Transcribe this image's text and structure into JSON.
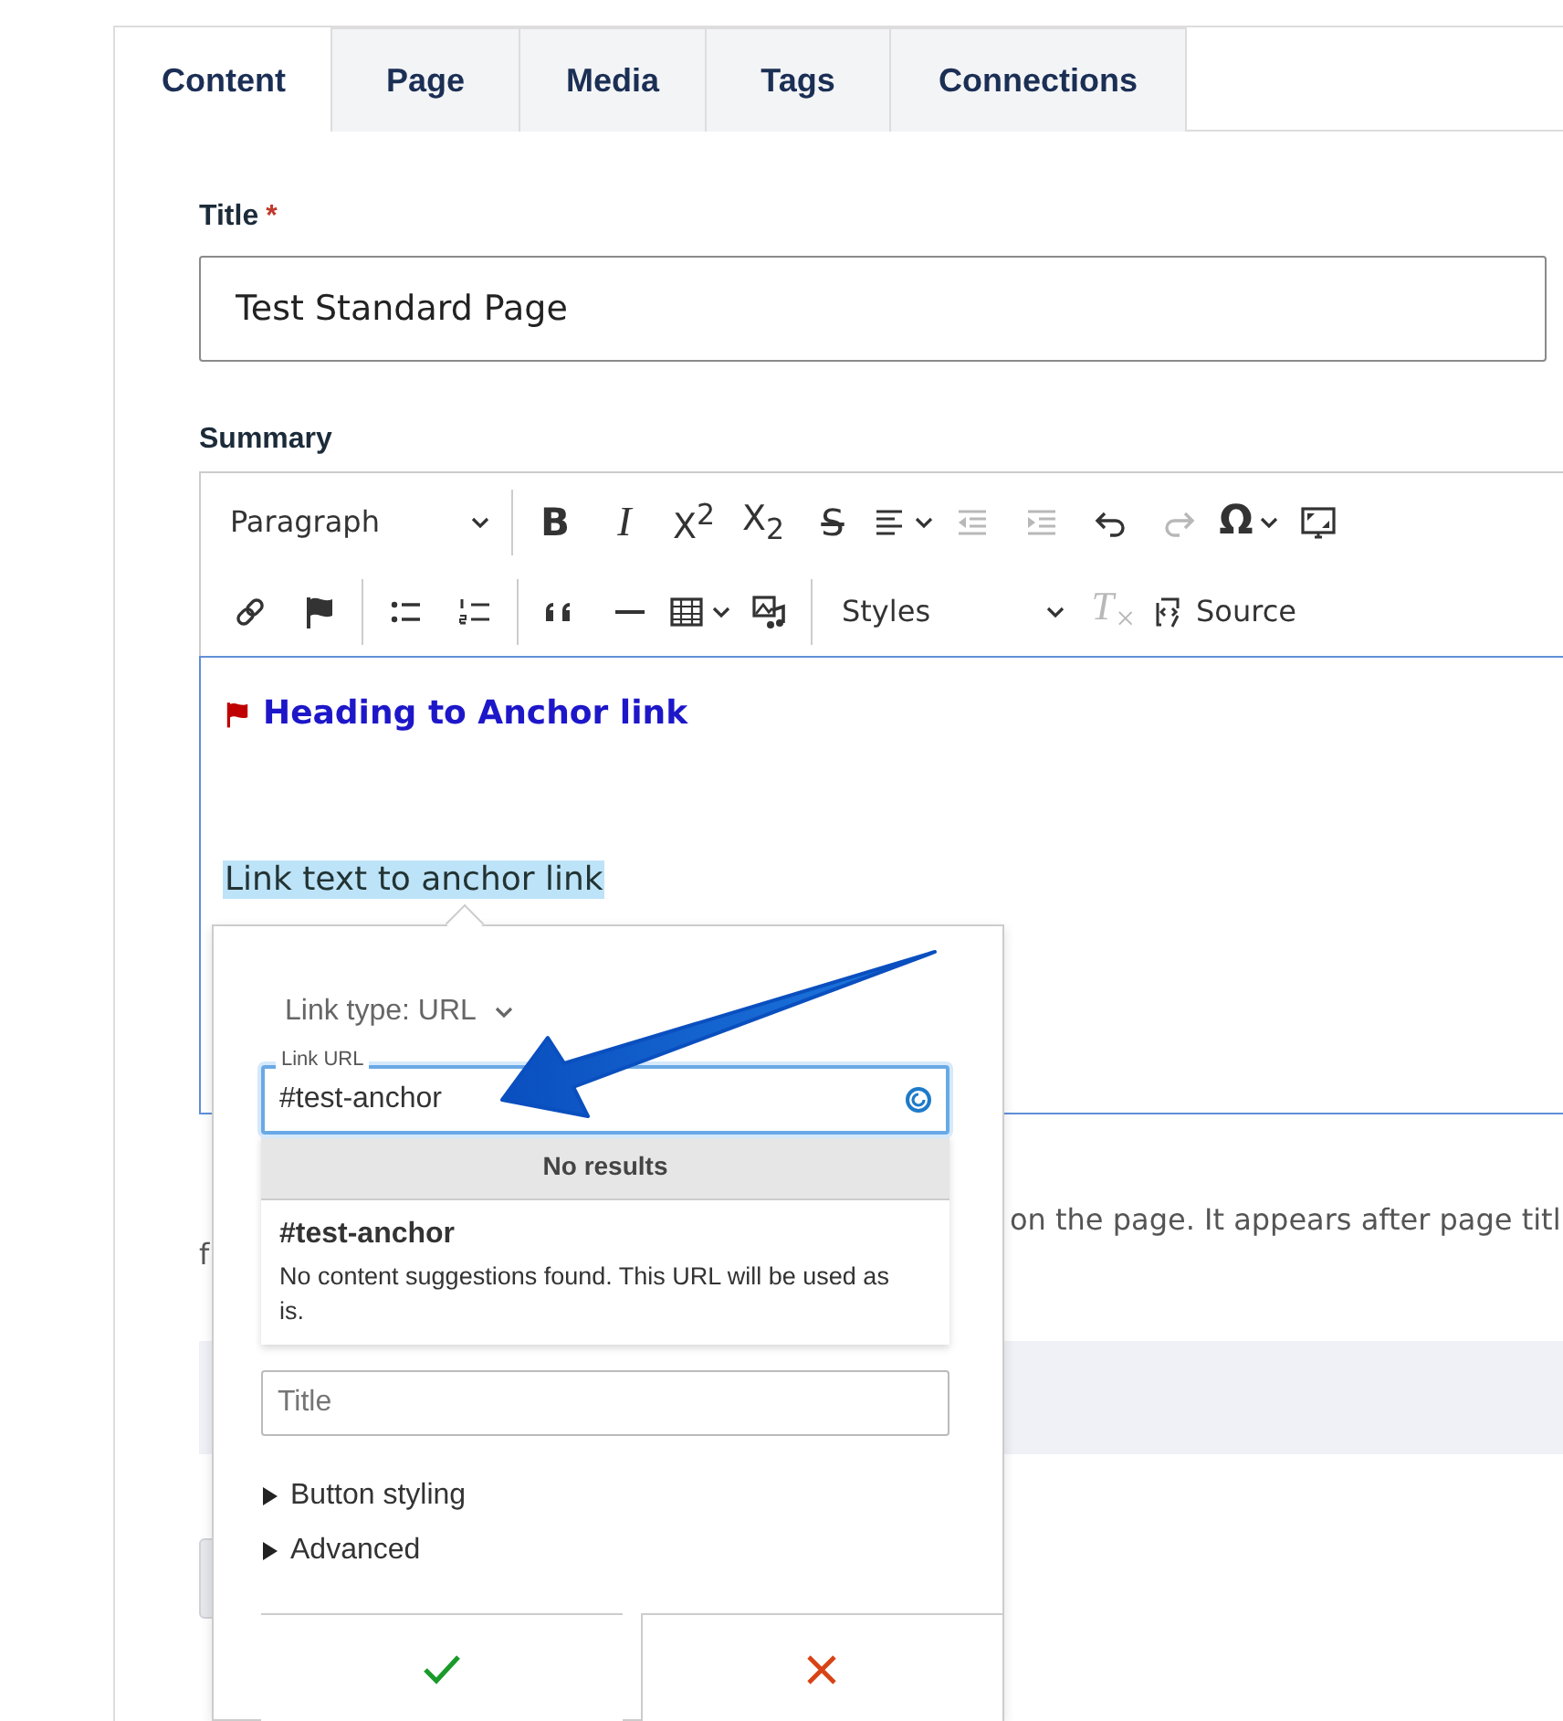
{
  "tabs": [
    {
      "label": "Content",
      "selected": true
    },
    {
      "label": "Page",
      "selected": false
    },
    {
      "label": "Media",
      "selected": false
    },
    {
      "label": "Tags",
      "selected": false
    },
    {
      "label": "Connections",
      "selected": false
    }
  ],
  "title_field": {
    "label": "Title",
    "required_mark": "*",
    "value": "Test Standard Page"
  },
  "summary": {
    "label": "Summary",
    "toolbar_row_1": [
      {
        "kind": "dropdown",
        "label": "Paragraph"
      },
      {
        "kind": "separator"
      },
      {
        "kind": "bold",
        "glyph": "B",
        "disabled": false
      },
      {
        "kind": "italic",
        "glyph": "I",
        "disabled": false
      },
      {
        "kind": "superscript",
        "glyph": "X$^{2}$",
        "disabled": false
      },
      {
        "kind": "subscript",
        "glyph": "X$_{2}$",
        "disabled": false
      },
      {
        "kind": "strikethrough",
        "glyph": "S",
        "disabled": false
      },
      {
        "kind": "align",
        "disabled": false
      },
      {
        "kind": "outdent",
        "disabled": true
      },
      {
        "kind": "indent",
        "disabled": true
      },
      {
        "kind": "undo",
        "disabled": false
      },
      {
        "kind": "redo",
        "disabled": true
      },
      {
        "kind": "special-characters",
        "glyph": "Ω",
        "disabled": false
      },
      {
        "kind": "fullscreen",
        "disabled": false
      }
    ],
    "toolbar_row_2": [
      {
        "kind": "link",
        "disabled": false
      },
      {
        "kind": "anchor",
        "disabled": false
      },
      {
        "kind": "separator"
      },
      {
        "kind": "bulleted-list",
        "disabled": false
      },
      {
        "kind": "numbered-list",
        "disabled": false
      },
      {
        "kind": "separator"
      },
      {
        "kind": "blockquote",
        "disabled": false
      },
      {
        "kind": "horizontal-line",
        "disabled": false
      },
      {
        "kind": "table",
        "disabled": false
      },
      {
        "kind": "media",
        "disabled": false
      },
      {
        "kind": "separator"
      },
      {
        "kind": "dropdown",
        "label": "Styles"
      },
      {
        "kind": "clear-format",
        "glyph": "T$_{×}$",
        "disabled": true
      },
      {
        "kind": "source",
        "label": "Source",
        "disabled": false
      }
    ],
    "content": {
      "heading": "Heading to Anchor link",
      "link_text": "Link text to anchor link",
      "link_selected": true
    }
  },
  "below_fields": {
    "description_end": "on the page. It appears after page titl",
    "description_line_2": "f"
  },
  "link_popup": {
    "link_type": "Link type: URL",
    "url_field": {
      "label": "Link URL",
      "value": "#test-anchor",
      "focused": true
    },
    "results_header": "No results",
    "suggestion": {
      "title": "#test-anchor",
      "note": "No content suggestions found. This URL will be used as is."
    },
    "title_field": {
      "placeholder": "Title"
    },
    "sections": [
      {
        "label": "Button styling",
        "expanded": false
      },
      {
        "label": "Advanced",
        "expanded": false
      }
    ]
  }
}
